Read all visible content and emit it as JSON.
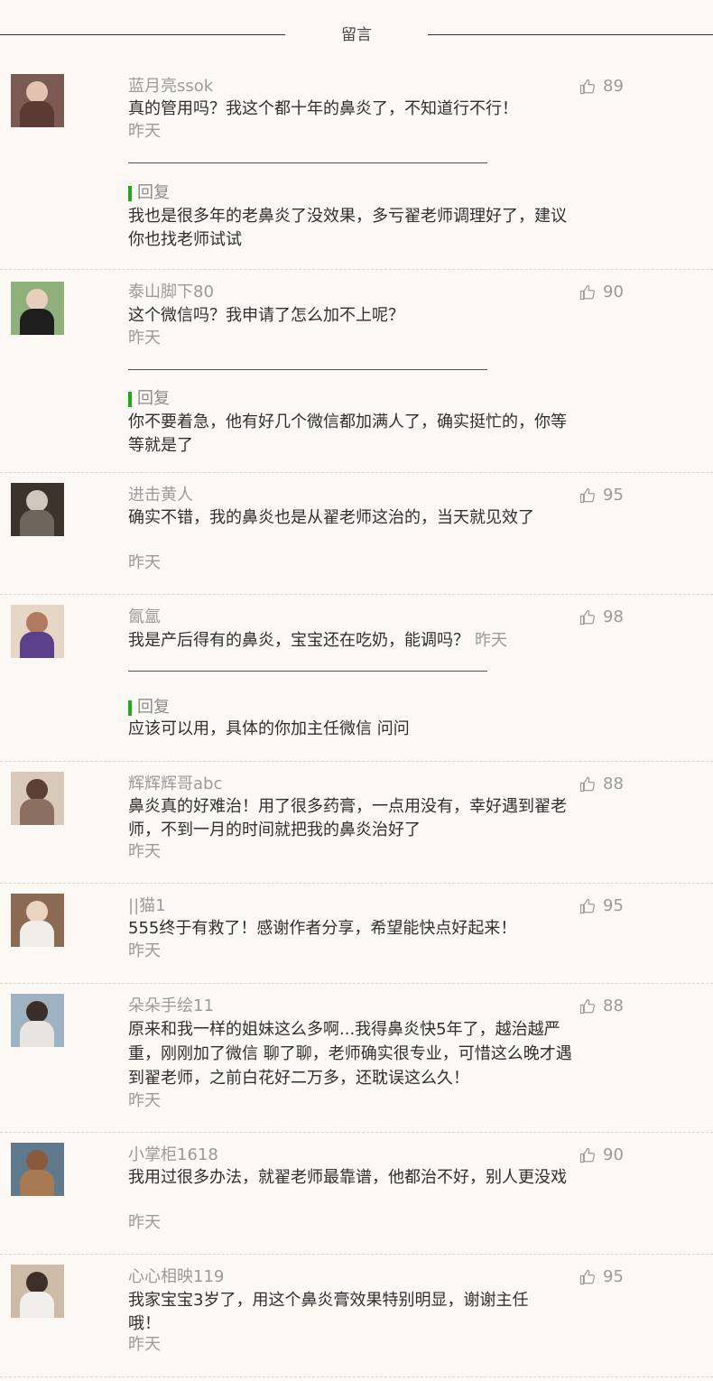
{
  "header": {
    "title": "留言"
  },
  "comments": [
    {
      "nick": "蓝月亮ssok",
      "text": "真的管用吗？我这个都十年的鼻炎了，不知道行不行！",
      "time": "昨天",
      "likes": "89",
      "reply_label": "回复",
      "reply": "我也是很多年的老鼻炎了没效果，多亏翟老师调理好了，建议你也找老师试试",
      "avatar_bg": "#7a5a52"
    },
    {
      "nick": "泰山脚下80",
      "text": "这个微信吗？我申请了怎么加不上呢？",
      "time": "昨天",
      "likes": "90",
      "reply_label": "回复",
      "reply": "你不要着急，他有好几个微信都加满人了，确实挺忙的，你等等就是了",
      "avatar_bg": "#6f8f5a"
    },
    {
      "nick": "进击黄人",
      "text": "确实不错，我的鼻炎也是从翟老师这治的，当天就见效了",
      "time": "昨天",
      "likes": "95",
      "avatar_bg": "#4a4038"
    },
    {
      "nick": "氤氲",
      "text": "我是产后得有的鼻炎，宝宝还在吃奶，能调吗？",
      "time": "昨天",
      "likes": "98",
      "reply_label": "回复",
      "reply": "应该可以用，具体的你加主任微信 问问",
      "avatar_bg": "#d9c7b6"
    },
    {
      "nick": "辉辉辉哥abc",
      "text": "鼻炎真的好难治！用了很多药膏，一点用没有，幸好遇到翟老师，不到一月的时间就把我的鼻炎治好了",
      "time": "昨天",
      "likes": "88",
      "avatar_bg": "#b9a89a"
    },
    {
      "nick": "||猫1",
      "text": "555终于有救了！感谢作者分享，希望能快点好起来！",
      "time": "昨天",
      "likes": "95",
      "avatar_bg": "#a07a5e"
    },
    {
      "nick": "朵朵手绘11",
      "text": "原来和我一样的姐妹这么多啊...我得鼻炎快5年了，越治越严重，刚刚加了微信 聊了聊，老师确实很专业，可惜这么晚才遇到翟老师，之前白花好二万多，还耽误这么久！",
      "time": "昨天",
      "likes": "88",
      "avatar_bg": "#8aa0b4"
    },
    {
      "nick": "小掌柜1618",
      "text": "我用过很多办法，就翟老师最靠谱，他都治不好，别人更没戏",
      "time": "昨天",
      "likes": "90",
      "avatar_bg": "#7a6a5a"
    },
    {
      "nick": "心心相映119",
      "text": "我家宝宝3岁了，用这个鼻炎膏效果特别明显，谢谢主任哦！",
      "time": "昨天",
      "likes": "95",
      "avatar_bg": "#c9b8a6"
    }
  ]
}
